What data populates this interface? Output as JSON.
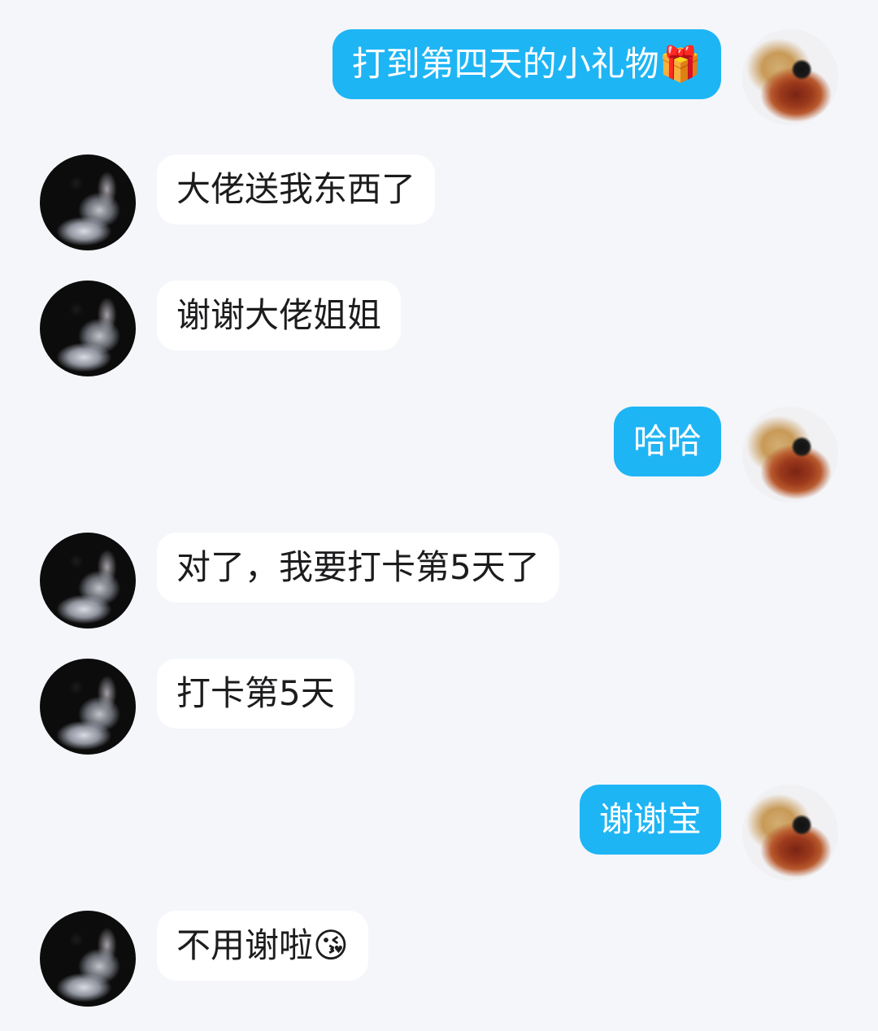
{
  "messages": [
    {
      "side": "out",
      "text": "打到第四天的小礼物🎁"
    },
    {
      "side": "in",
      "text": "大佬送我东西了"
    },
    {
      "side": "in",
      "text": "谢谢大佬姐姐"
    },
    {
      "side": "out",
      "text": "哈哈"
    },
    {
      "side": "in",
      "text": "对了，我要打卡第5天了"
    },
    {
      "side": "in",
      "text": "打卡第5天"
    },
    {
      "side": "out",
      "text": "谢谢宝"
    },
    {
      "side": "in",
      "text": "不用谢啦😘"
    }
  ],
  "colors": {
    "background": "#f4f6fa",
    "outgoing_bubble": "#1eb5f5",
    "incoming_bubble": "#ffffff"
  },
  "icons": {
    "incoming_avatar": "girl-avatar",
    "outgoing_avatar": "dog-avatar"
  }
}
